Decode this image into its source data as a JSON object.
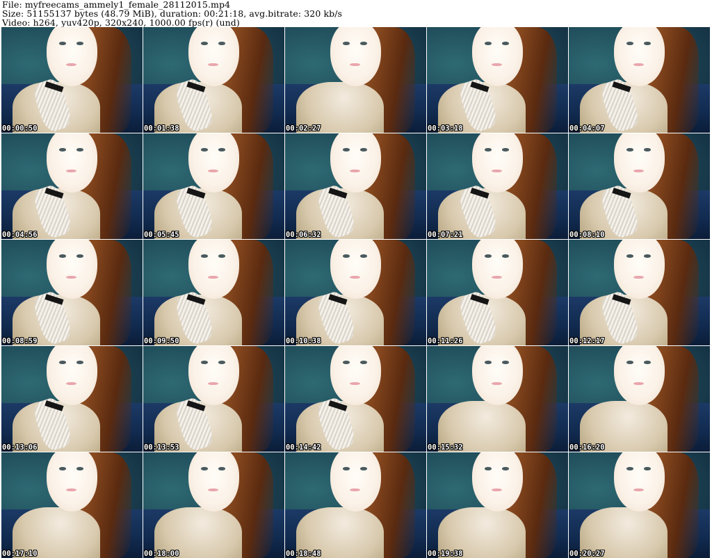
{
  "header": {
    "file_line": "File: myfreecams_ammely1_female_28112015.mp4",
    "size_line": "Size: 51155137 bytes (48.79 MiB), duration: 00:21:18, avg.bitrate: 320 kb/s",
    "video_line": "Video: h264, yuv420p, 320x240, 1000.00 fps(r) (und)"
  },
  "thumbnails": [
    {
      "timestamp": "00:00:50",
      "pose": "hand"
    },
    {
      "timestamp": "00:01:38",
      "pose": "hand"
    },
    {
      "timestamp": "00:02:27",
      "pose": "no-hand"
    },
    {
      "timestamp": "00:03:18",
      "pose": "hand"
    },
    {
      "timestamp": "00:04:07",
      "pose": "hand"
    },
    {
      "timestamp": "00:04:56",
      "pose": "hand"
    },
    {
      "timestamp": "00:05:45",
      "pose": "hand"
    },
    {
      "timestamp": "00:06:32",
      "pose": "hand"
    },
    {
      "timestamp": "00:07:21",
      "pose": "hand"
    },
    {
      "timestamp": "00:08:10",
      "pose": "hand"
    },
    {
      "timestamp": "00:08:59",
      "pose": "hand"
    },
    {
      "timestamp": "00:09:50",
      "pose": "hand"
    },
    {
      "timestamp": "00:10:38",
      "pose": "hand"
    },
    {
      "timestamp": "00:11:26",
      "pose": "hand"
    },
    {
      "timestamp": "00:12:17",
      "pose": "hand"
    },
    {
      "timestamp": "00:13:06",
      "pose": "hand"
    },
    {
      "timestamp": "00:13:53",
      "pose": "hand"
    },
    {
      "timestamp": "00:14:42",
      "pose": "hand"
    },
    {
      "timestamp": "00:15:32",
      "pose": "no-hand"
    },
    {
      "timestamp": "00:16:20",
      "pose": "no-hand"
    },
    {
      "timestamp": "00:17:10",
      "pose": "no-hand"
    },
    {
      "timestamp": "00:18:00",
      "pose": "no-hand"
    },
    {
      "timestamp": "00:18:48",
      "pose": "no-hand"
    },
    {
      "timestamp": "00:19:38",
      "pose": "no-hand"
    },
    {
      "timestamp": "00:20:27",
      "pose": "no-hand"
    }
  ],
  "colors": {
    "background": "#ffffff",
    "timestamp_text": "#ffffff",
    "timestamp_outline": "#000000",
    "backdrop": "#1f4a58",
    "sofa": "#112a4f"
  }
}
